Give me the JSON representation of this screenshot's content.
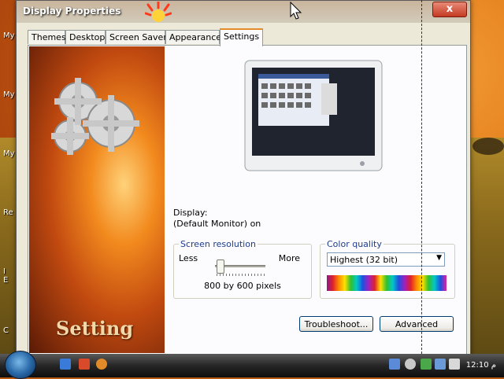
{
  "window": {
    "title": "Display Properties",
    "close_label": "x"
  },
  "desktop": {
    "icons": [
      "My D",
      "My",
      "My",
      "Re",
      "I\nE",
      "C"
    ]
  },
  "tabs": [
    {
      "label": "Themes"
    },
    {
      "label": "Desktop"
    },
    {
      "label": "Screen Saver"
    },
    {
      "label": "Appearance"
    },
    {
      "label": "Settings"
    }
  ],
  "active_tab": "Settings",
  "side_art": {
    "title": "Setting"
  },
  "display": {
    "label": "Display:",
    "value": "(Default Monitor) on"
  },
  "resolution": {
    "legend": "Screen resolution",
    "less": "Less",
    "more": "More",
    "value": "800 by 600 pixels"
  },
  "color_quality": {
    "legend": "Color quality",
    "selected": "Highest (32 bit)"
  },
  "buttons": {
    "troubleshoot": "Troubleshoot...",
    "advanced": "Advanced"
  },
  "taskbar": {
    "time": "12:10 م"
  },
  "colors": {
    "accent": "#e68b2c",
    "legend": "#1e3c8c",
    "button_border": "#003c74"
  }
}
